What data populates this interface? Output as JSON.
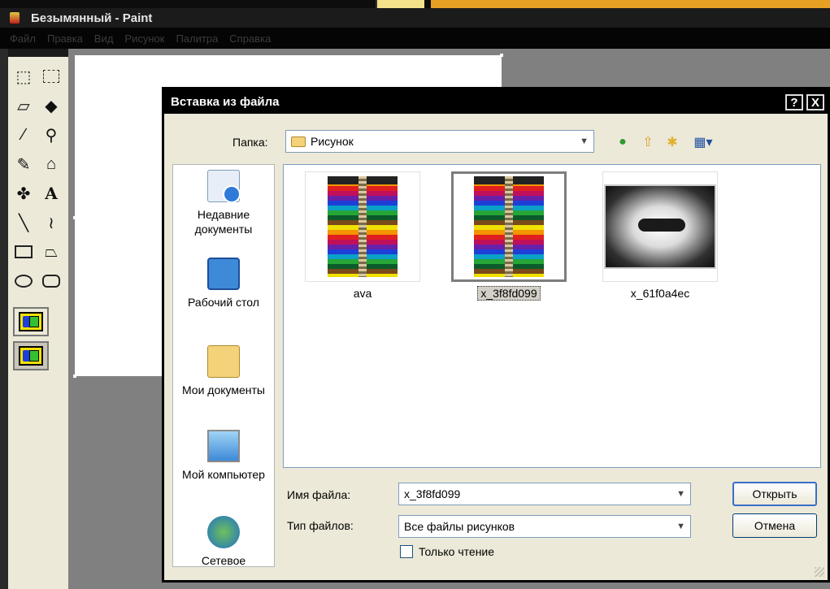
{
  "window": {
    "title": "Безымянный - Paint",
    "app_icon": "paint-app-icon"
  },
  "menubar": {
    "items": [
      "Файл",
      "Правка",
      "Вид",
      "Рисунок",
      "Палитра",
      "Справка"
    ]
  },
  "toolbox": {
    "tools": [
      "free-select-icon",
      "rect-select-icon",
      "eraser-icon",
      "fill-icon",
      "color-picker-icon",
      "magnifier-icon",
      "pencil-icon",
      "brush-icon",
      "airbrush-icon",
      "text-icon",
      "line-icon",
      "curve-icon",
      "rectangle-icon",
      "polygon-icon",
      "ellipse-icon",
      "rounded-rect-icon"
    ],
    "text_tool_glyph": "A"
  },
  "dialog": {
    "title": "Вставка из файла",
    "help_button": "?",
    "close_button": "X",
    "folder_label": "Папка:",
    "folder_value": "Рисунок",
    "places": [
      {
        "label": "Недавние документы",
        "icon": "recent-docs-icon"
      },
      {
        "label": "Рабочий стол",
        "icon": "desktop-icon"
      },
      {
        "label": "Мои документы",
        "icon": "my-documents-icon"
      },
      {
        "label": "Мой компьютер",
        "icon": "my-computer-icon"
      },
      {
        "label": "Сетевое",
        "icon": "network-icon"
      }
    ],
    "files": [
      {
        "name": "ava",
        "selected": false
      },
      {
        "name": "x_3f8fd099",
        "selected": true
      },
      {
        "name": "x_61f0a4ec",
        "selected": false
      }
    ],
    "filename_label": "Имя файла:",
    "filename_value": "x_3f8fd099",
    "filetype_label": "Тип файлов:",
    "filetype_value": "Все файлы рисунков",
    "readonly_label": "Только чтение",
    "readonly_checked": false,
    "open_button": "Открыть",
    "cancel_button": "Отмена"
  }
}
